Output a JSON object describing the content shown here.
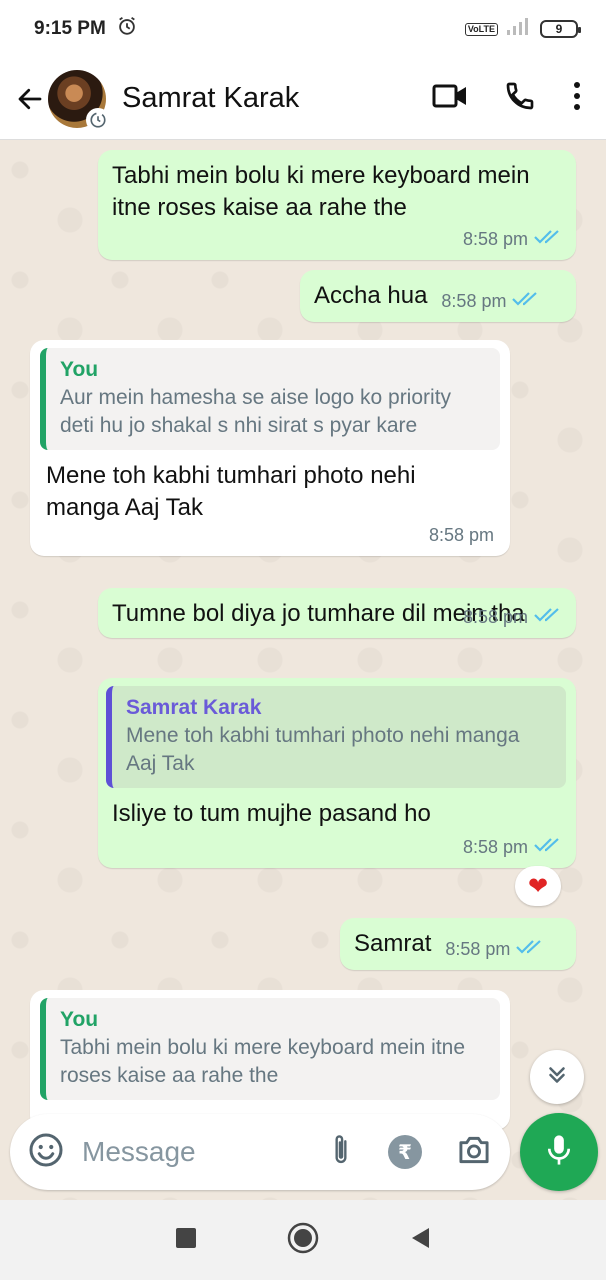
{
  "status_bar": {
    "time": "9:15 PM",
    "volte": "VoLTE",
    "battery": "9"
  },
  "header": {
    "contact_name": "Samrat Karak"
  },
  "messages": [
    {
      "text": "Tabhi mein bolu ki mere keyboard mein itne roses kaise aa rahe the",
      "time": "8:58 pm"
    },
    {
      "text": "Accha hua",
      "time": "8:58 pm"
    },
    {
      "quote_name": "You",
      "quote_text": "Aur mein hamesha se aise logo ko priority deti hu jo shakal s nhi sirat s pyar kare",
      "text": "Mene toh kabhi tumhari photo nehi manga Aaj Tak",
      "time": "8:58 pm"
    },
    {
      "text": "Tumne bol diya jo tumhare dil mein tha",
      "time": "8:58 pm"
    },
    {
      "quote_name": "Samrat Karak",
      "quote_text": "Mene toh kabhi tumhari photo nehi manga Aaj Tak",
      "text": "Isliye to tum mujhe pasand ho",
      "time": "8:58 pm",
      "reaction": "❤"
    },
    {
      "text": "Samrat",
      "time": "8:58 pm"
    },
    {
      "quote_name": "You",
      "quote_text": "Tabhi mein bolu ki mere keyboard mein itne roses kaise aa rahe the"
    }
  ],
  "input": {
    "placeholder": "Message",
    "rupee": "₹"
  },
  "colors": {
    "accent": "#1fa855",
    "outgoing_bubble": "#d9fdd3",
    "read_ticks": "#53bdeb"
  },
  "icons": [
    "back-arrow-icon",
    "video-call-icon",
    "voice-call-icon",
    "more-vert-icon",
    "emoji-icon",
    "attach-icon",
    "rupee-icon",
    "camera-icon",
    "mic-icon",
    "scroll-down-icon",
    "nav-recents-icon",
    "nav-home-icon",
    "nav-back-icon"
  ]
}
